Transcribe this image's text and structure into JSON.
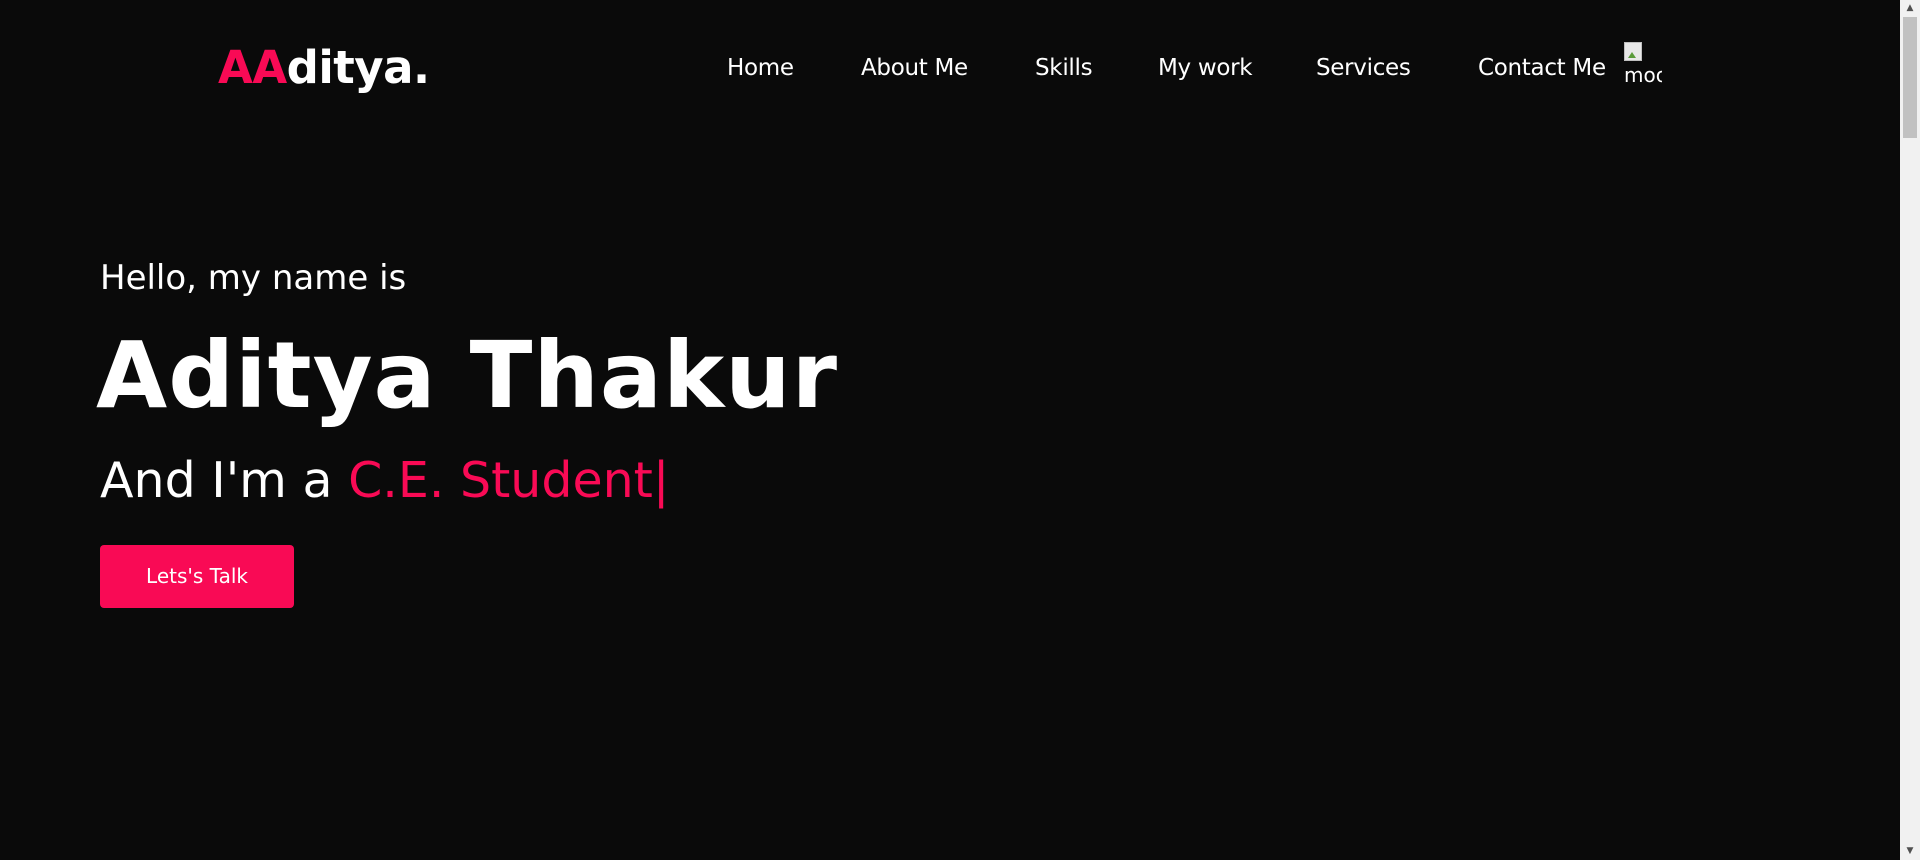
{
  "logo": {
    "accent": "AA",
    "rest": "ditya."
  },
  "nav": {
    "items": [
      {
        "label": "Home"
      },
      {
        "label": "About Me"
      },
      {
        "label": "Skills"
      },
      {
        "label": "My work"
      },
      {
        "label": "Services"
      },
      {
        "label": "Contact Me"
      }
    ],
    "image_alt": "moo"
  },
  "hero": {
    "greeting": "Hello, my name is",
    "name": "Aditya Thakur",
    "role_prefix": "And I'm a ",
    "role_typed": "C.E. Student",
    "cursor": "|",
    "cta_label": "Lets's Talk"
  },
  "colors": {
    "accent": "#f90a55",
    "background": "#0a0a0a",
    "text": "#ffffff"
  },
  "icons": {
    "broken_image": "broken-image-icon",
    "scroll_up": "chevron-up-icon",
    "scroll_down": "chevron-down-icon"
  }
}
